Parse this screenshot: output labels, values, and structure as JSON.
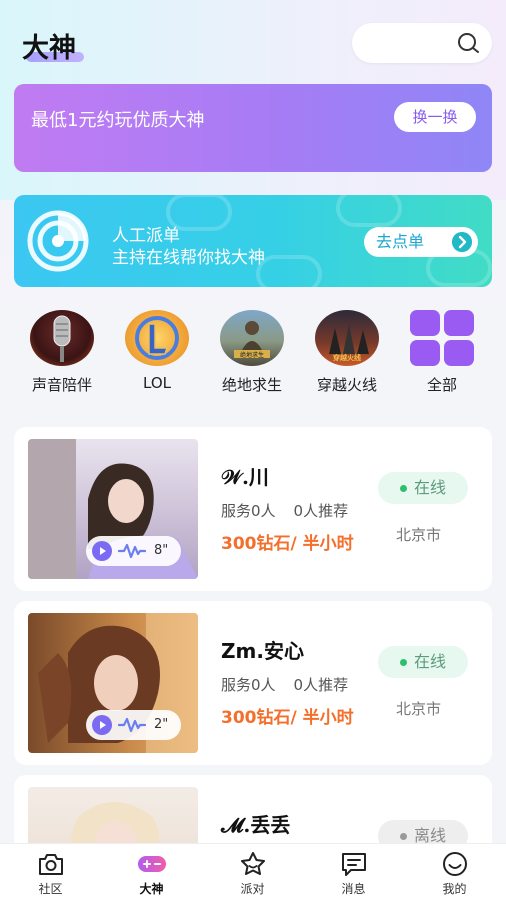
{
  "header": {
    "title": "大神",
    "search_placeholder": ""
  },
  "banner_promo": {
    "text": "最低1元约玩优质大神",
    "button": "换一换"
  },
  "banner_dispatch": {
    "title": "人工派单",
    "subtitle": "主持在线帮你找大神",
    "button": "去点单"
  },
  "categories": [
    {
      "label": "声音陪伴",
      "icon": "microphone-icon"
    },
    {
      "label": "LOL",
      "icon": "lol-logo-icon"
    },
    {
      "label": "绝地求生",
      "icon": "pubg-icon"
    },
    {
      "label": "穿越火线",
      "icon": "crossfire-icon"
    },
    {
      "label": "全部",
      "icon": "grid-icon"
    }
  ],
  "players": [
    {
      "name": "𝒲.川",
      "services": "服务0人",
      "recommend": "0人推荐",
      "price": "300钻石/ 半小时",
      "status": "在线",
      "city": "北京市",
      "voice": "8\""
    },
    {
      "name": "Zm.安心",
      "services": "服务0人",
      "recommend": "0人推荐",
      "price": "300钻石/ 半小时",
      "status": "在线",
      "city": "北京市",
      "voice": "2\""
    },
    {
      "name": "𝓜.丢丢",
      "status": "离线"
    }
  ],
  "tabs": [
    {
      "label": "社区",
      "icon": "camera-icon"
    },
    {
      "label": "大神",
      "icon": "gamepad-icon"
    },
    {
      "label": "派对",
      "icon": "star-icon"
    },
    {
      "label": "消息",
      "icon": "message-icon"
    },
    {
      "label": "我的",
      "icon": "smile-icon"
    }
  ],
  "colors": {
    "accent_purple": "#a67cf5",
    "accent_cyan": "#3bc7f2",
    "price_orange": "#f36f2b",
    "online_green": "#2fbf6c"
  }
}
